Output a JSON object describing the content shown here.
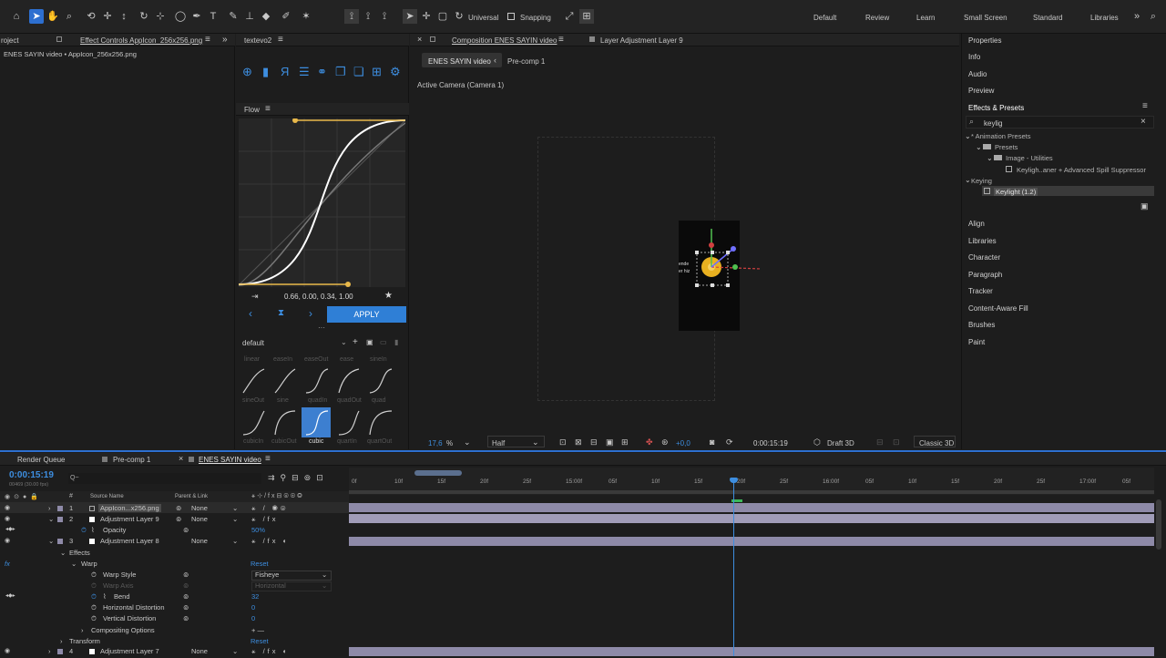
{
  "toolbar": {
    "universal_label": "Universal",
    "snapping_label": "Snapping",
    "workspaces": [
      "Default",
      "Review",
      "Learn",
      "Small Screen",
      "Standard",
      "Libraries"
    ]
  },
  "project_panel": {
    "tab_project": "roject",
    "tab_effect_controls": "Effect Controls AppIcon_256x256.png",
    "breadcrumb": "ENES SAYIN video • AppIcon_256x256.png"
  },
  "textevo": {
    "tab": "textevo2",
    "flow_tab": "Flow",
    "bezier_values": "0.66, 0.00, 0.34, 1.00",
    "apply_label": "APPLY",
    "preset_select": "default",
    "preset_names_row1": [
      "linear",
      "easeIn",
      "easeOut",
      "ease",
      "sineIn"
    ],
    "preset_names_row2": [
      "sineOut",
      "sine",
      "quadIn",
      "quadOut",
      "quad"
    ],
    "preset_names_row3": [
      "cubicIn",
      "cubicOut",
      "cubic",
      "quartIn",
      "quartOut"
    ]
  },
  "composition": {
    "tab_label": "Composition ENES SAYIN video",
    "layer_tab": "Layer Adjustment Layer 9",
    "crumb_active": "ENES SAYIN video",
    "crumb_next": "Pre-comp 1",
    "camera_label": "Active Camera (Camera 1)",
    "overlay_text_1": "ende",
    "overlay_text_2": "er hiz",
    "zoom": "17,6",
    "zoom_unit": "%",
    "resolution": "Half",
    "exposure": "+0,0",
    "timecode": "0:00:15:19",
    "renderer": "Draft 3D",
    "renderer_mode": "Classic 3D"
  },
  "right_panel": {
    "items_top": [
      "Properties",
      "Info",
      "Audio",
      "Preview"
    ],
    "effects_presets_title": "Effects & Presets",
    "search_value": "keylig",
    "tree": {
      "animation_presets": "* Animation Presets",
      "presets": "Presets",
      "image_utilities": "Image - Utilities",
      "keylight_preset": "Keyligh..aner + Advanced Spill Suppressor",
      "keying": "Keying",
      "keylight": "Keylight (1.2)"
    },
    "items_bottom": [
      "Align",
      "Libraries",
      "Character",
      "Paragraph",
      "Tracker",
      "Content-Aware Fill",
      "Brushes",
      "Paint"
    ]
  },
  "timeline": {
    "tabs": [
      "Render Queue",
      "Pre-comp 1",
      "ENES SAYIN video"
    ],
    "timecode": "0:00:15:19",
    "frames_info": "00469 (30.00 fps)",
    "search_placeholder": "Q~",
    "col_num": "#",
    "col_source": "Source Name",
    "col_parent": "Parent & Link",
    "ruler_ticks": [
      "0f",
      "10f",
      "15f",
      "20f",
      "25f",
      "15:00f",
      "05f",
      "10f",
      "15f",
      "20f",
      "25f",
      "16:00f",
      "05f",
      "10f",
      "15f",
      "20f",
      "25f",
      "17:00f",
      "05f"
    ],
    "layers": [
      {
        "num": "1",
        "name": "AppIcon...x256.png",
        "parent": "None"
      },
      {
        "num": "2",
        "name": "Adjustment Layer 9",
        "parent": "None"
      },
      {
        "num": "3",
        "name": "Adjustment Layer 8",
        "parent": "None"
      },
      {
        "num": "4",
        "name": "Adjustment Layer 7",
        "parent": "None"
      }
    ],
    "opacity_label": "Opacity",
    "opacity_value": "50%",
    "effects_label": "Effects",
    "warp_label": "Warp",
    "reset_label": "Reset",
    "warp_style_label": "Warp Style",
    "warp_style_value": "Fisheye",
    "warp_axis_label": "Warp Axis",
    "warp_axis_value": "Horizontal",
    "bend_label": "Bend",
    "bend_value": "32",
    "hdist_label": "Horizontal Distortion",
    "hdist_value": "0",
    "vdist_label": "Vertical Distortion",
    "vdist_value": "0",
    "compositing_label": "Compositing Options",
    "compositing_value": "+ —",
    "transform_label": "Transform",
    "transform_reset": "Reset"
  }
}
